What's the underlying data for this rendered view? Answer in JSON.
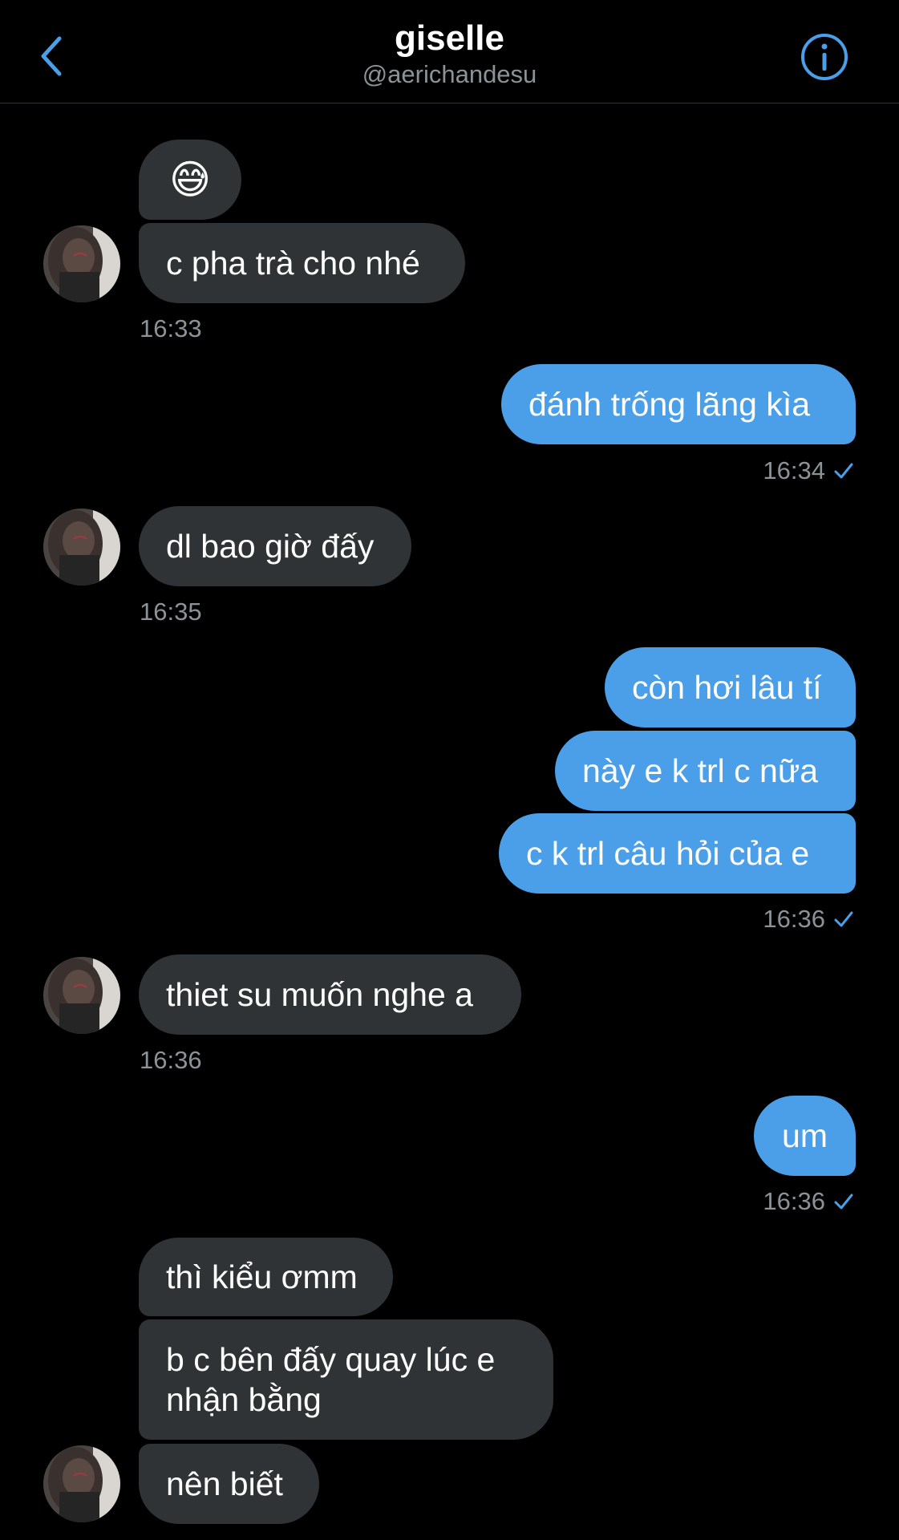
{
  "header": {
    "name": "giselle",
    "handle": "@aerichandesu",
    "back_icon": "chevron-left-icon",
    "info_icon": "info-icon"
  },
  "colors": {
    "background": "#000000",
    "incoming_bubble": "#2f3336",
    "outgoing_bubble": "#4a9fe8",
    "accent": "#4a9fe8",
    "timestamp": "#8b9298"
  },
  "messages": {
    "m1": {
      "emoji": "😅",
      "emoji_icon": "grinning-sweat-emoji-icon"
    },
    "m2": {
      "text": "c pha trà cho nhé"
    },
    "t1": {
      "time": "16:33"
    },
    "m3": {
      "text": "đánh trống lãng kìa"
    },
    "t2": {
      "time": "16:34"
    },
    "m4": {
      "text": "dl bao giờ đấy"
    },
    "t3": {
      "time": "16:35"
    },
    "m5": {
      "text": "còn hơi lâu tí"
    },
    "m6": {
      "text": "này e k trl c nữa"
    },
    "m7": {
      "text": "c k trl câu hỏi của e"
    },
    "t4": {
      "time": "16:36"
    },
    "m8": {
      "text": "thiet su muốn nghe a"
    },
    "t5": {
      "time": "16:36"
    },
    "m9": {
      "text": "um"
    },
    "t6": {
      "time": "16:36"
    },
    "m10": {
      "text": "thì kiểu ơmm"
    },
    "m11": {
      "line1": "b c bên đấy quay lúc e",
      "line2": "nhận bằng"
    },
    "m12": {
      "text": "nên biết"
    }
  }
}
